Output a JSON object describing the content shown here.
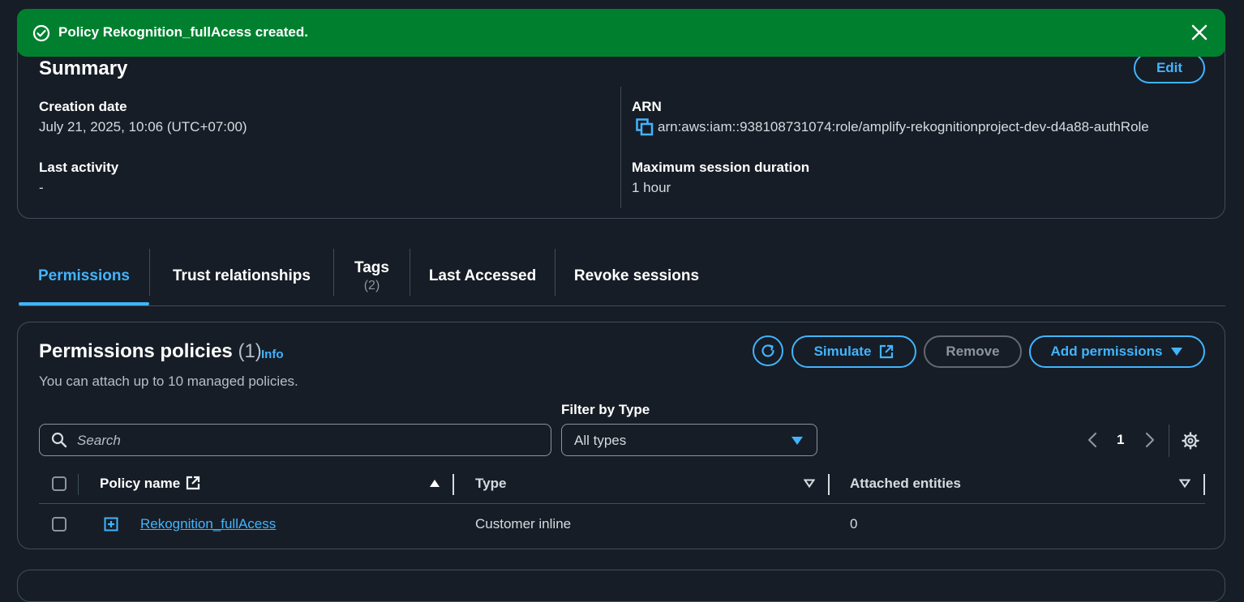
{
  "flash": {
    "message": "Policy Rekognition_fullAcess created."
  },
  "summary": {
    "title": "Summary",
    "edit_label": "Edit",
    "creation_date_label": "Creation date",
    "creation_date_value": "July 21, 2025, 10:06 (UTC+07:00)",
    "last_activity_label": "Last activity",
    "last_activity_value": "-",
    "arn_label": "ARN",
    "arn_value": "arn:aws:iam::938108731074:role/amplify-rekognitionproject-dev-d4a88-authRole",
    "max_session_label": "Maximum session duration",
    "max_session_value": "1 hour"
  },
  "tabs": [
    {
      "label": "Permissions",
      "count": ""
    },
    {
      "label": "Trust relationships",
      "count": ""
    },
    {
      "label": "Tags",
      "count": "(2)"
    },
    {
      "label": "Last Accessed",
      "count": ""
    },
    {
      "label": "Revoke sessions",
      "count": ""
    }
  ],
  "permissions": {
    "title": "Permissions policies",
    "count": "(1)",
    "info_label": "Info",
    "description": "You can attach up to 10 managed policies.",
    "simulate_label": "Simulate",
    "remove_label": "Remove",
    "add_label": "Add permissions",
    "filter_label": "Filter by Type",
    "search_placeholder": "Search",
    "filter_value": "All types",
    "page_number": "1",
    "columns": {
      "policy_name": "Policy name",
      "type": "Type",
      "attached_entities": "Attached entities"
    },
    "rows": [
      {
        "policy_name": "Rekognition_fullAcess",
        "type": "Customer inline",
        "attached_entities": "0"
      }
    ]
  },
  "colors": {
    "accent": "#42b4ff",
    "success": "#00802f",
    "background": "#161d26",
    "border": "#414d5c"
  },
  "icons": [
    "check-circle-icon",
    "close-icon",
    "copy-icon",
    "refresh-icon",
    "external-link-icon",
    "caret-down-icon",
    "search-icon",
    "chevron-left-icon",
    "chevron-right-icon",
    "gear-icon",
    "sort-asc-icon",
    "sort-desc-icon",
    "expand-icon"
  ]
}
